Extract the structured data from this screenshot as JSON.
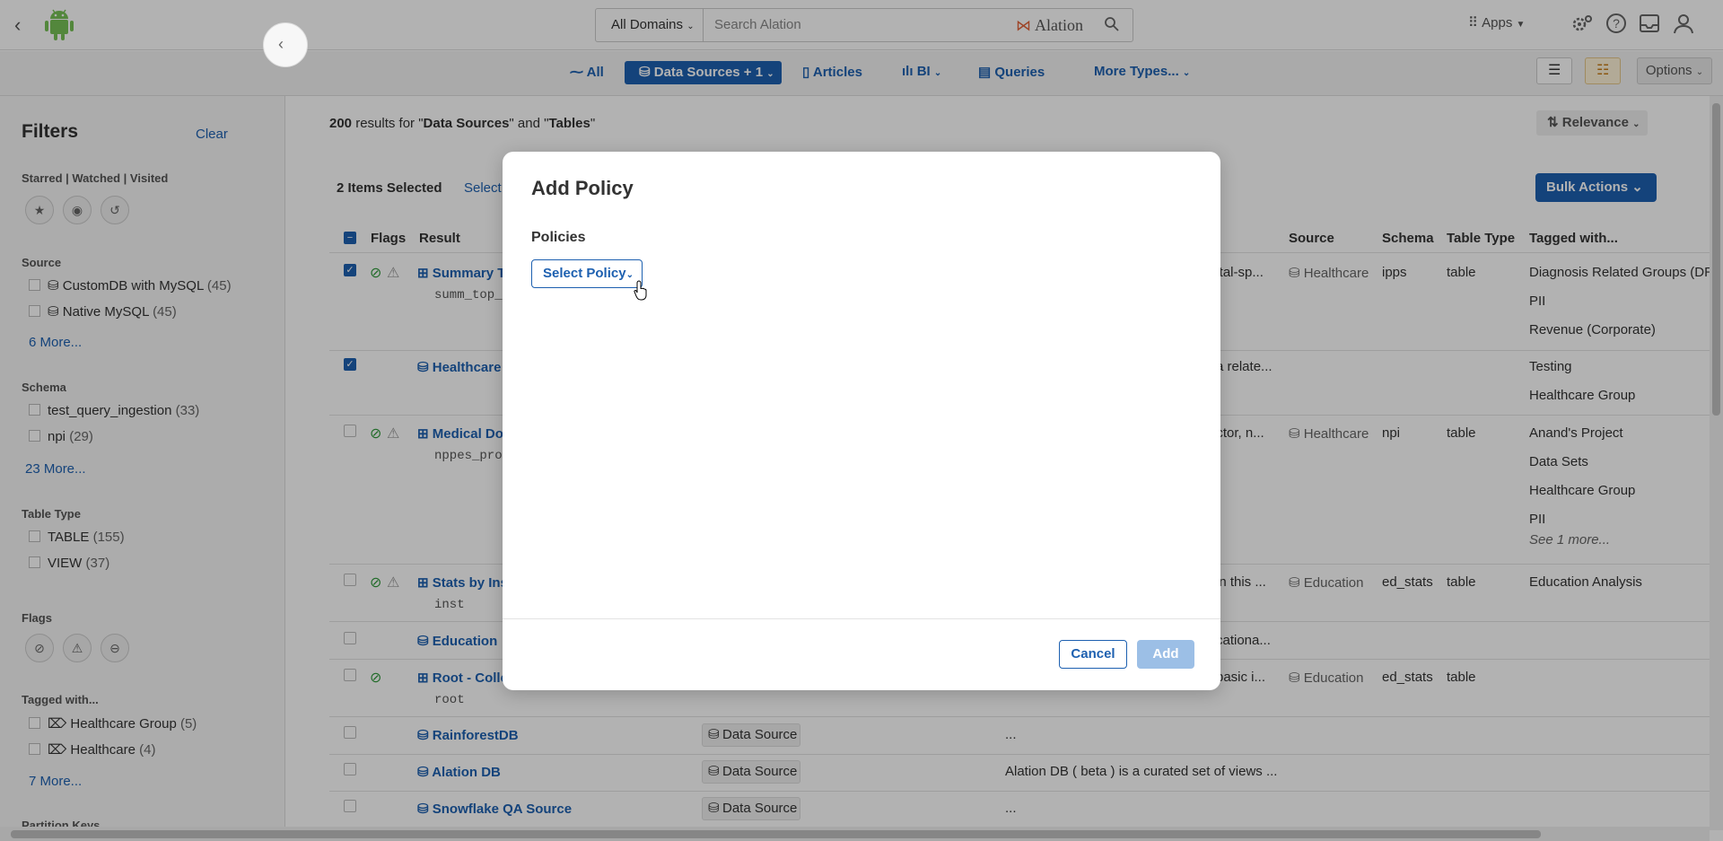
{
  "topbar": {
    "domains_label": "All Domains",
    "search_placeholder": "Search Alation",
    "logo_text": "Alation",
    "apps_label": "Apps"
  },
  "typebar": {
    "all": "All",
    "data_sources": "Data Sources + 1",
    "articles": "Articles",
    "bi": "BI",
    "queries": "Queries",
    "more_types": "More Types...",
    "options": "Options"
  },
  "filters": {
    "title": "Filters",
    "clear": "Clear",
    "starred_label": "Starred | Watched | Visited",
    "source_label": "Source",
    "source_items": [
      {
        "label": "CustomDB with MySQL",
        "count": "(45)"
      },
      {
        "label": "Native MySQL",
        "count": "(45)"
      }
    ],
    "source_more": "6 More...",
    "schema_label": "Schema",
    "schema_items": [
      {
        "label": "test_query_ingestion",
        "count": "(33)"
      },
      {
        "label": "npi",
        "count": "(29)"
      }
    ],
    "schema_more": "23 More...",
    "tabletype_label": "Table Type",
    "tabletype_items": [
      {
        "label": "TABLE",
        "count": "(155)"
      },
      {
        "label": "VIEW",
        "count": "(37)"
      }
    ],
    "flags_label": "Flags",
    "tagged_label": "Tagged with...",
    "tagged_items": [
      {
        "label": "Healthcare Group",
        "count": "(5)"
      },
      {
        "label": "Healthcare",
        "count": "(4)"
      }
    ],
    "tagged_more": "7 More...",
    "partition_label": "Partition Keys"
  },
  "results": {
    "count": "200",
    "summary_mid": " results for \"",
    "q1": "Data Sources",
    "and": "\" and \"",
    "q2": "Tables",
    "end": "\"",
    "relevance": "Relevance",
    "selected": "2 Items Selected",
    "select_link": "Select",
    "bulk_actions": "Bulk Actions",
    "headers": {
      "flags": "Flags",
      "result": "Result",
      "source": "Source",
      "schema": "Schema",
      "table_type": "Table Type",
      "tagged": "Tagged with..."
    },
    "rows": [
      {
        "title": "Summary T",
        "sub": "summ_top_",
        "desc": "pital-sp...",
        "source": "Healthcare",
        "schema": "ipps",
        "type": "table",
        "tags": [
          "Diagnosis Related Groups (DR",
          "PII",
          "Revenue (Corporate)"
        ]
      },
      {
        "title": "Healthcare",
        "desc": "a relate...",
        "tags": [
          "Testing",
          "Healthcare Group"
        ]
      },
      {
        "title": "Medical Do",
        "sub": "nppes_pro",
        "desc": "octor, n...",
        "source": "Healthcare",
        "schema": "npi",
        "type": "table",
        "tags": [
          "Anand's Project",
          "Data Sets",
          "Healthcare Group",
          "PII"
        ],
        "see_more": "See 1 more..."
      },
      {
        "title": "Stats by Ins",
        "sub": "inst",
        "desc": "in this ...",
        "source": "Education",
        "schema": "ed_stats",
        "type": "table",
        "tags": [
          "Education Analysis"
        ]
      },
      {
        "title": "Education",
        "desc": "cationa..."
      },
      {
        "title": "Root - Colle",
        "sub": "root",
        "desc": "basic i...",
        "source": "Education",
        "schema": "ed_stats",
        "type": "table"
      },
      {
        "title": "RainforestDB",
        "badge": "Data Source",
        "desc": "..."
      },
      {
        "title": "Alation DB",
        "badge": "Data Source",
        "desc": "Alation DB ( beta ) is a curated set of views ..."
      },
      {
        "title": "Snowflake QA Source",
        "badge": "Data Source",
        "desc": "..."
      }
    ]
  },
  "modal": {
    "title": "Add Policy",
    "policies_label": "Policies",
    "select_policy": "Select Policy",
    "cancel": "Cancel",
    "add": "Add"
  },
  "colors": {
    "accent": "#1d60b0",
    "android": "#78c257",
    "ok": "#2e9a3a"
  }
}
